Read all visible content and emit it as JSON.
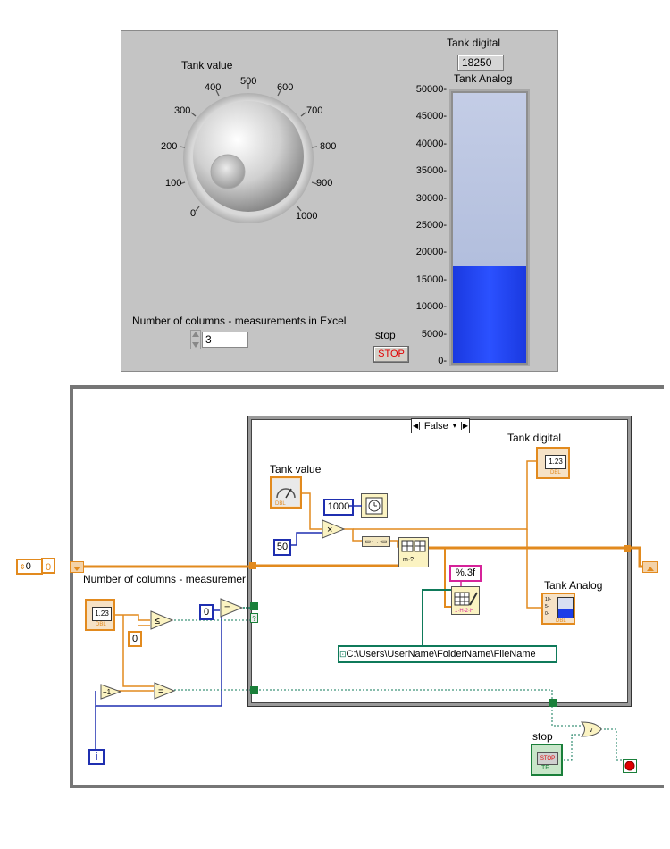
{
  "front_panel": {
    "knob": {
      "label": "Tank value",
      "ticks": [
        "0",
        "100",
        "200",
        "300",
        "400",
        "500",
        "600",
        "700",
        "800",
        "900",
        "1000"
      ]
    },
    "tank_digital": {
      "label": "Tank digital",
      "value": "18250"
    },
    "tank_analog": {
      "label": "Tank Analog",
      "scale": [
        "50000-",
        "45000-",
        "40000-",
        "35000-",
        "30000-",
        "25000-",
        "20000-",
        "15000-",
        "10000-",
        "5000-",
        "0-"
      ],
      "fill_level": 0.365
    },
    "columns_control": {
      "label": "Number of columns - measurements in Excel",
      "value": "3"
    },
    "stop": {
      "label": "stop",
      "button_text": "STOP"
    }
  },
  "block_diagram": {
    "case_selector": "False",
    "case_arrow_left": "◀",
    "case_arrow_right": "▶",
    "tank_value_label": "Tank value",
    "tank_digital_label": "Tank digital",
    "tank_analog_label": "Tank Analog",
    "const_1000": "1000",
    "const_50": "50",
    "format_string": "%.3f",
    "file_path": "C:\\Users\\UserName\\FolderName\\FileName",
    "columns_label": "Number of columns - measuremer",
    "const_0_left": "0",
    "const_0_right": "0",
    "const_0_mid": "0",
    "const_0_eq": "0",
    "iteration_label": "i",
    "stop_label": "stop",
    "dbl_tag": "DBL",
    "num_tag": "1.23",
    "tf_tag": "TF",
    "stop_tag": "STOP",
    "plus_one": "+1",
    "multiply": "×",
    "equals": "=",
    "less_eq": "≤",
    "or_label": "OR",
    "selector_q": "?",
    "waveform_scale_top": "10-",
    "waveform_scale_mid": "5-",
    "waveform_scale_bot": "0-"
  },
  "colors": {
    "orange_wire": "#e28a1e",
    "blue_wire": "#1f2fb0",
    "green_wire": "#0f7a5a",
    "panel_bg": "#c4c4c4",
    "tank_fill": "#1c3de8"
  }
}
